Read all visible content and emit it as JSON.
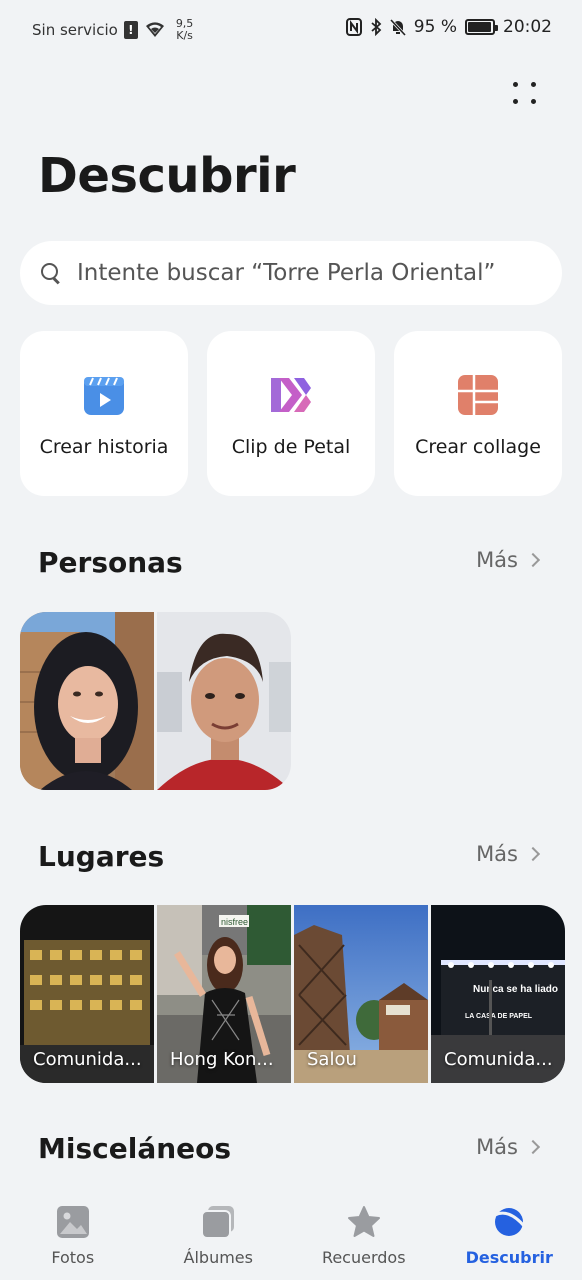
{
  "status_bar": {
    "carrier": "Sin servicio",
    "sim_alert": "!",
    "net_speed_value": "9,5",
    "net_speed_unit": "K/s",
    "battery_percent": "95 %",
    "battery_level": 0.95,
    "time": "20:02"
  },
  "page_title": "Descubrir",
  "search": {
    "placeholder": "Intente buscar “Torre Perla Oriental”"
  },
  "actions": [
    {
      "label": "Crear historia",
      "icon": "story-video-icon"
    },
    {
      "label": "Clip de Petal",
      "icon": "petal-clip-icon"
    },
    {
      "label": "Crear collage",
      "icon": "collage-icon"
    }
  ],
  "sections": {
    "people": {
      "title": "Personas",
      "more": "Más"
    },
    "places": {
      "title": "Lugares",
      "more": "Más"
    },
    "misc": {
      "title": "Misceláneos",
      "more": "Más"
    }
  },
  "places": [
    {
      "label": "Comunida..."
    },
    {
      "label": "Hong Kon..."
    },
    {
      "label": "Salou"
    },
    {
      "label": "Comunida..."
    }
  ],
  "place_overlays": {
    "sign_text": "Nunca se ha liado",
    "sign_logo": "LA CASA DE PAPEL",
    "shop_sign": "nisfree"
  },
  "tabs": [
    {
      "label": "Fotos",
      "icon": "photo-icon"
    },
    {
      "label": "Álbumes",
      "icon": "albums-icon"
    },
    {
      "label": "Recuerdos",
      "icon": "star-icon"
    },
    {
      "label": "Descubrir",
      "icon": "discover-icon",
      "active": true
    }
  ],
  "colors": {
    "accent": "#2561e0",
    "background": "#f1f3f5",
    "card": "#ffffff"
  }
}
